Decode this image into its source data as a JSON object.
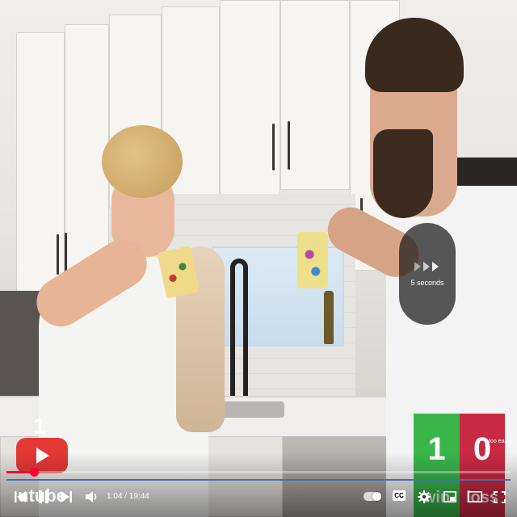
{
  "seek_overlay": {
    "label": "5 seconds",
    "icon": "fast-forward-icon"
  },
  "channel_badge": {
    "number": "1",
    "word": "utube"
  },
  "scoreboard": {
    "win": {
      "value": "1",
      "label": "win",
      "color": "#3ab54a"
    },
    "lose": {
      "value": "0",
      "label": "loss",
      "color": "#c92a43"
    },
    "note": "too easy!"
  },
  "player": {
    "current_time": "1:04",
    "duration": "19:44",
    "time_display": "1:04 / 19:44",
    "progress": 0.054,
    "accent_color": "#ff0033",
    "controls": [
      "previous-icon",
      "pause-icon",
      "next-icon",
      "volume-icon",
      "autoplay-toggle",
      "captions-icon",
      "settings-icon",
      "miniplayer-icon",
      "theater-mode-icon",
      "fullscreen-icon"
    ],
    "captions_label": "CC"
  }
}
